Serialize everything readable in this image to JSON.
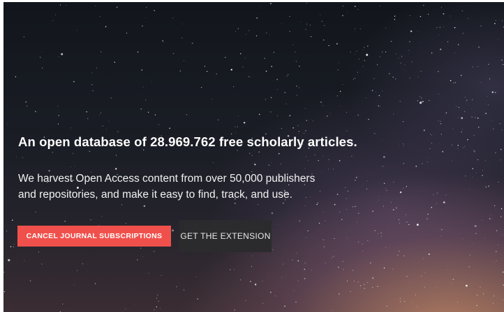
{
  "hero": {
    "headline": "An open database of 28.969.762 free scholarly articles.",
    "subline_line1": "We harvest Open Access content from over 50,000 publishers",
    "subline_line2": "and repositories, and make it easy to find, track, and use."
  },
  "actions": {
    "cancel_label": "CANCEL JOURNAL SUBSCRIPTIONS",
    "extension_label": "GET THE EXTENSION"
  },
  "colors": {
    "primary_button": "#f0504c",
    "secondary_button": "#2b2b2e",
    "text": "#ffffff"
  }
}
